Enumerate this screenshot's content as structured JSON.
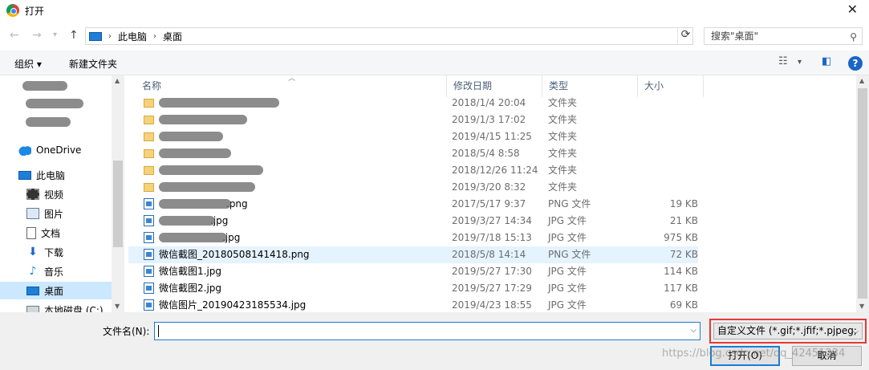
{
  "window": {
    "title": "打开",
    "close_label": "✕"
  },
  "nav": {
    "back": "←",
    "forward": "→",
    "recent": "▾",
    "up": "↑",
    "crumbs": [
      "此电脑",
      "桌面"
    ],
    "search_placeholder": "搜索\"桌面\""
  },
  "toolbar": {
    "organize": "组织 ▾",
    "new_folder": "新建文件夹"
  },
  "sidebar": {
    "items": [
      {
        "label": "OneDrive",
        "icon": "onedrive-icon"
      },
      {
        "label": "此电脑",
        "icon": "computer-icon"
      },
      {
        "label": "视频",
        "icon": "video-icon"
      },
      {
        "label": "图片",
        "icon": "pictures-icon"
      },
      {
        "label": "文档",
        "icon": "documents-icon"
      },
      {
        "label": "下载",
        "icon": "download-icon"
      },
      {
        "label": "音乐",
        "icon": "music-icon"
      },
      {
        "label": "桌面",
        "icon": "desktop-icon",
        "selected": true
      },
      {
        "label": "本地磁盘 (C:)",
        "icon": "drive-icon"
      }
    ]
  },
  "columns": {
    "name": "名称",
    "date": "修改日期",
    "type": "类型",
    "size": "大小"
  },
  "files": [
    {
      "name": "",
      "date": "2018/1/4 20:04",
      "type": "文件夹",
      "size": "",
      "kind": "folder"
    },
    {
      "name": "",
      "date": "2019/1/3 17:02",
      "type": "文件夹",
      "size": "",
      "kind": "folder"
    },
    {
      "name": "",
      "date": "2019/4/15 11:25",
      "type": "文件夹",
      "size": "",
      "kind": "folder"
    },
    {
      "name": "",
      "date": "2018/5/4 8:58",
      "type": "文件夹",
      "size": "",
      "kind": "folder"
    },
    {
      "name": "",
      "date": "2018/12/26 11:24",
      "type": "文件夹",
      "size": "",
      "kind": "folder"
    },
    {
      "name": "",
      "date": "2019/3/20 8:32",
      "type": "文件夹",
      "size": "",
      "kind": "folder"
    },
    {
      "name": ".png",
      "date": "2017/5/17 9:37",
      "type": "PNG 文件",
      "size": "19 KB",
      "kind": "image"
    },
    {
      "name": ".jpg",
      "date": "2019/3/27 14:34",
      "type": "JPG 文件",
      "size": "21 KB",
      "kind": "image"
    },
    {
      "name": ".jpg",
      "date": "2019/7/18 15:13",
      "type": "JPG 文件",
      "size": "975 KB",
      "kind": "image"
    },
    {
      "name": "微信截图_20180508141418.png",
      "date": "2018/5/8 14:14",
      "type": "PNG 文件",
      "size": "72 KB",
      "kind": "image",
      "selected": true
    },
    {
      "name": "微信截图1.jpg",
      "date": "2019/5/27 17:30",
      "type": "JPG 文件",
      "size": "114 KB",
      "kind": "image"
    },
    {
      "name": "微信截图2.jpg",
      "date": "2019/5/27 17:29",
      "type": "JPG 文件",
      "size": "117 KB",
      "kind": "image"
    },
    {
      "name": "微信图片_20190423185534.jpg",
      "date": "2019/4/23 18:55",
      "type": "JPG 文件",
      "size": "69 KB",
      "kind": "image"
    }
  ],
  "bottom": {
    "filename_label": "文件名(N):",
    "filename_value": "",
    "filter": "自定义文件 (*.gif;*.jfif;*.pjpeg;",
    "open_button": "打开(O)",
    "cancel_button": "取消",
    "watermark": "https://blog.csdn.net/qq_42451234"
  },
  "colors": {
    "accent": "#1c7bd4",
    "selection": "#cce8ff",
    "highlight_border": "#e53935"
  }
}
